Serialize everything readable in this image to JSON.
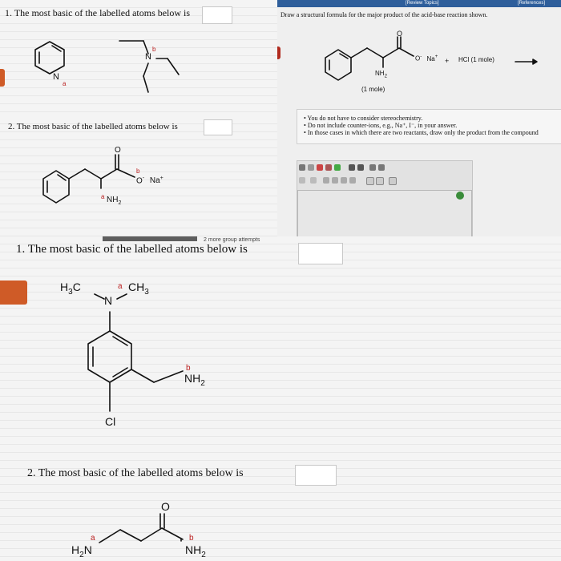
{
  "panel_q1": {
    "question": "1. The most basic of the labelled atoms below is",
    "label_a": "a",
    "label_b": "b",
    "atom_n": "N"
  },
  "panel_q2": {
    "question": "2. The most basic of the labelled atoms below is",
    "label_a": "a",
    "label_b": "b",
    "o_dbl": "O",
    "o_minus": "O",
    "minus": "-",
    "na": "Na",
    "plus_sup": "+",
    "nh2": "NH",
    "nh2_sub": "2"
  },
  "panel_topright": {
    "header_left": "[Review Topics]",
    "header_right": "[References]",
    "instruction": "Draw a structural formula for the major product of the acid-base reaction shown.",
    "o_dbl": "O",
    "o_minus_na": "O",
    "minus": "-",
    "na": "Na",
    "na_plus": "+",
    "plus": "+",
    "hcl": "HCl (1 mole)",
    "nh2": "NH",
    "nh2_sub": "2",
    "one_mole": "(1 mole)",
    "bullets": [
      "You do not have to consider stereochemistry.",
      "Do not include counter-ions, e.g., Na⁺, I⁻, in your answer.",
      "In those cases in which there are two reactants, draw only the product from the compound"
    ]
  },
  "panel_bottom": {
    "partial_header": "2 more group attempts",
    "q1": "1. The most basic of the labelled atoms below is",
    "h3c": "H",
    "h3c_sub": "3",
    "h3c_c": "C",
    "ch3_c": "CH",
    "ch3_sub": "3",
    "n": "N",
    "label_a": "a",
    "label_b": "b",
    "nh2": "NH",
    "nh2_sub": "2",
    "cl": "Cl",
    "q2": "2. The most basic of the labelled atoms below is",
    "o": "O",
    "h2n_h": "H",
    "h2n_sub": "2",
    "h2n_n": "N",
    "nh2_b": "NH",
    "nh2_b_sub": "2",
    "q2_label_a": "a",
    "q2_label_b": "b"
  }
}
